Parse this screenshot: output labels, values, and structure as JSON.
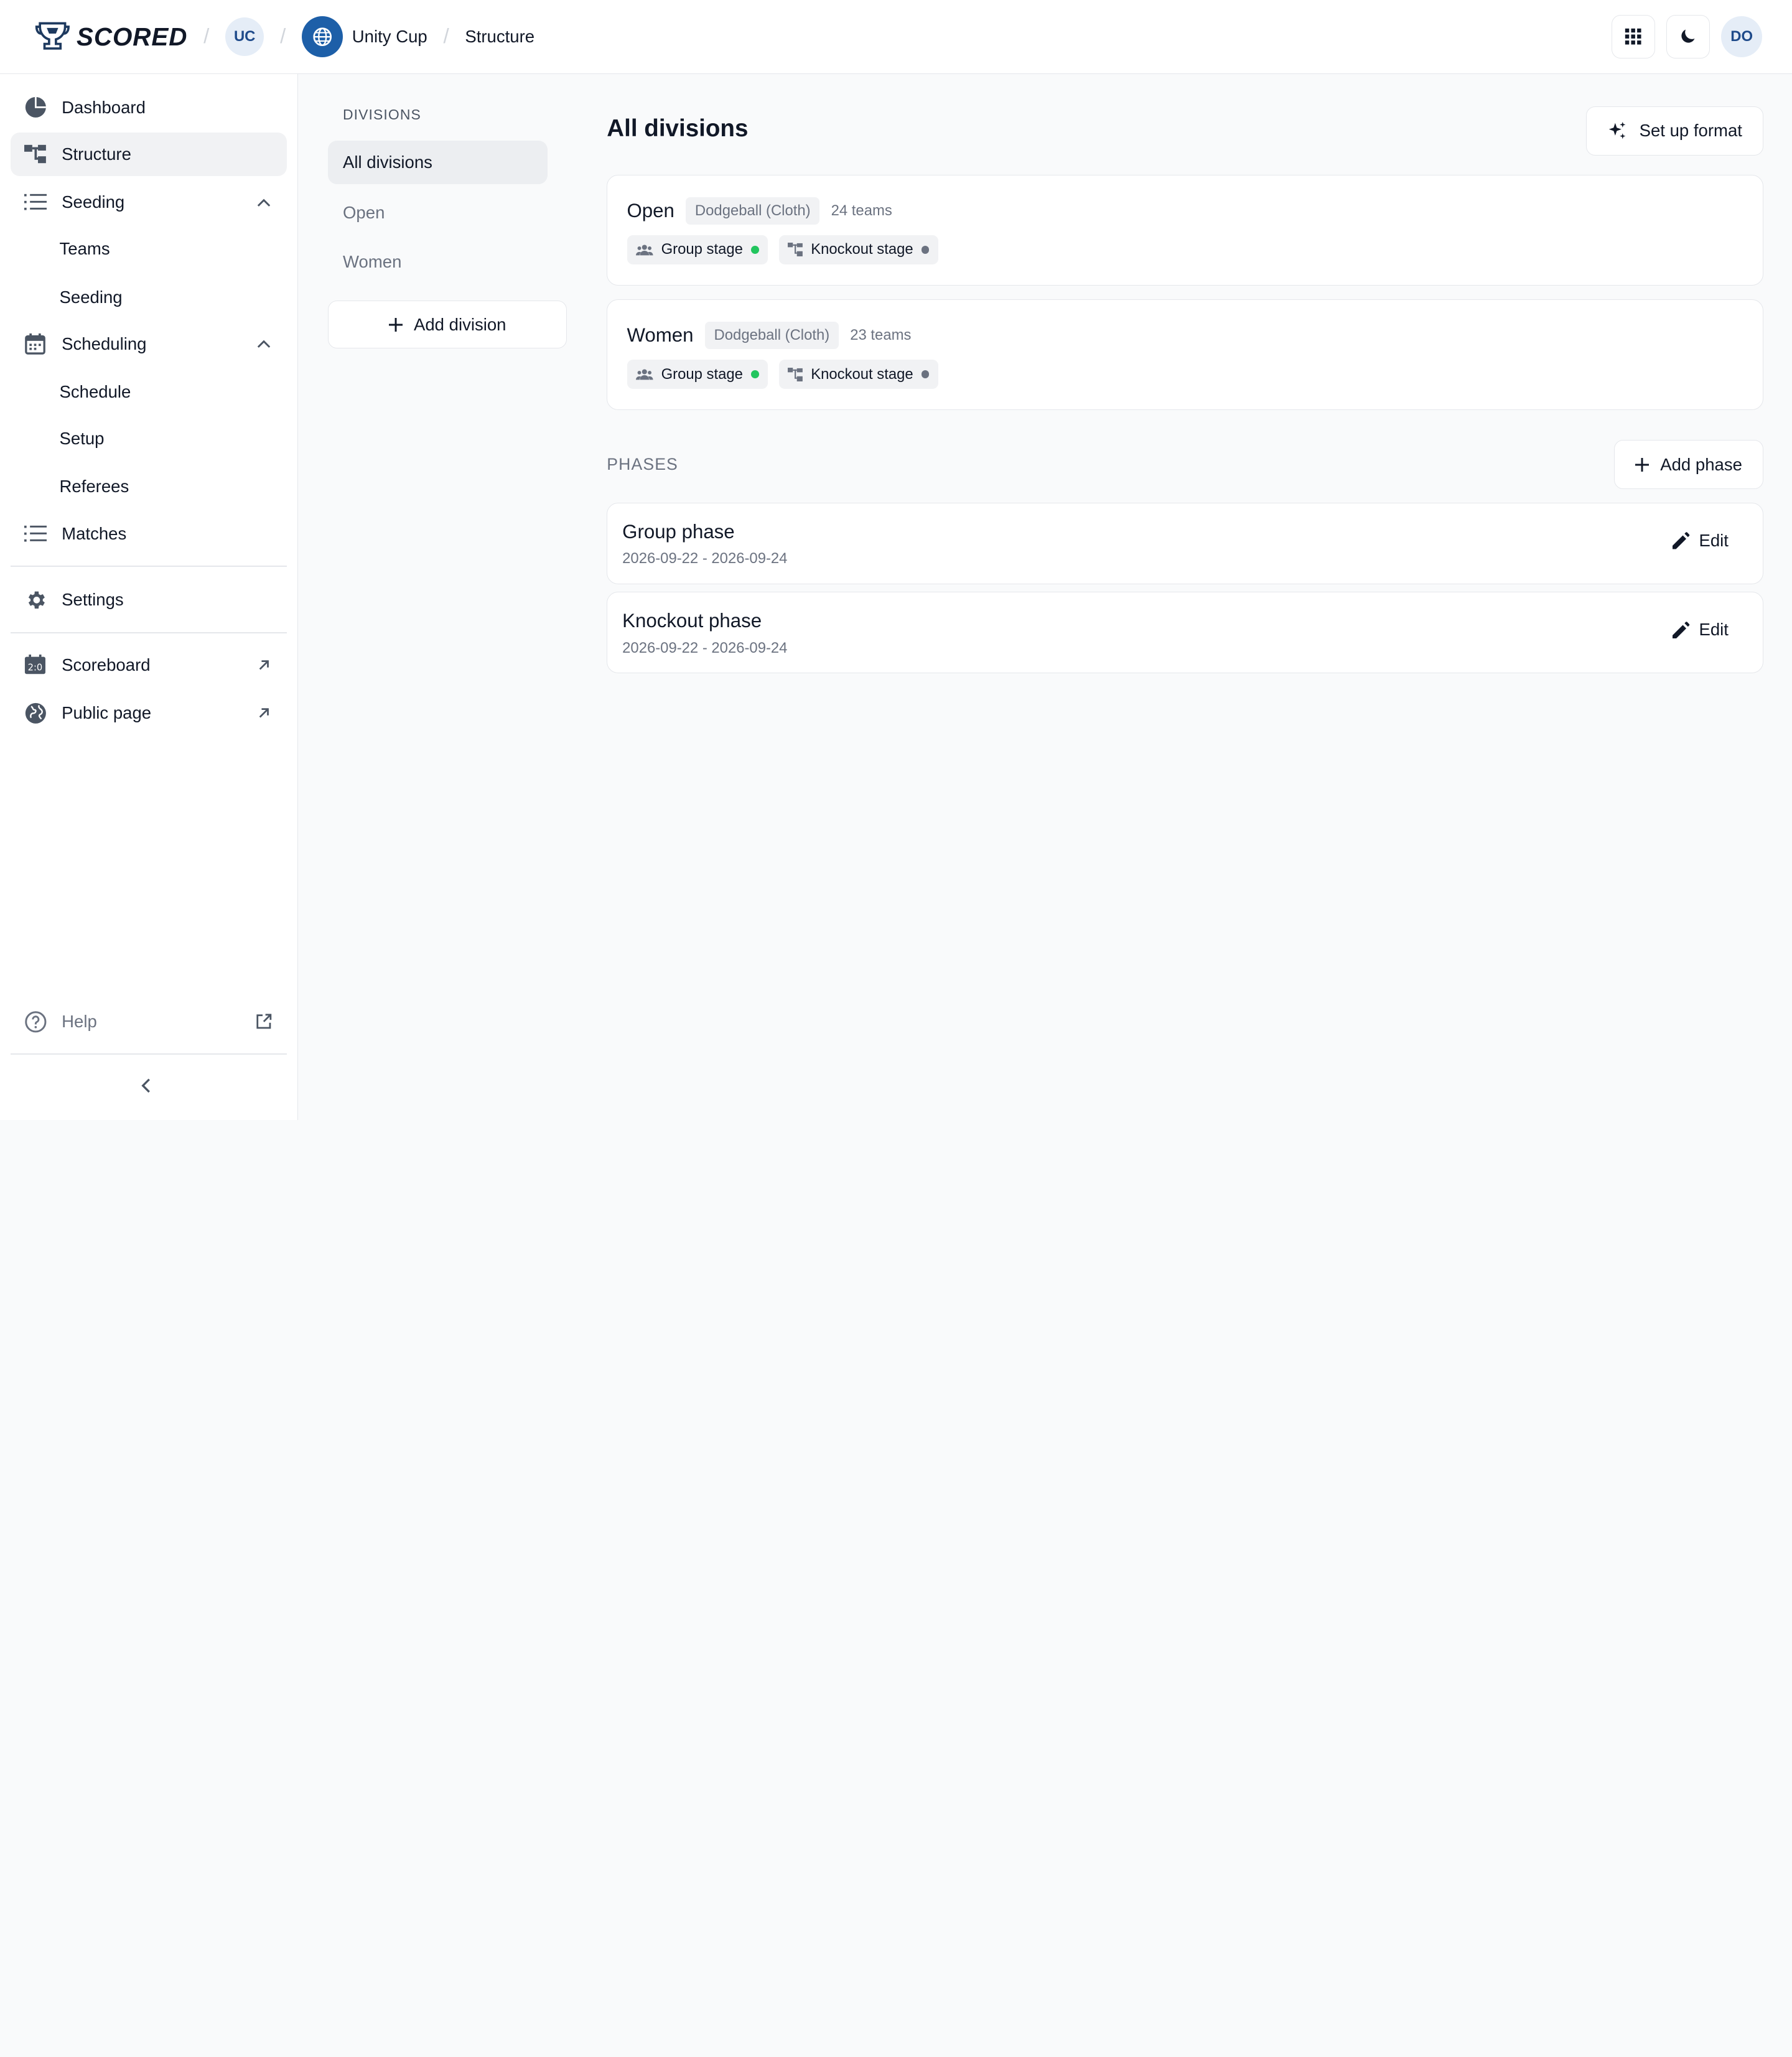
{
  "header": {
    "brand": "SCORED",
    "org_initials": "UC",
    "tournament": "Unity Cup",
    "page": "Structure",
    "user_initials": "DO",
    "icons": [
      "apps-grid-icon",
      "moon-icon"
    ]
  },
  "sidebar": {
    "dashboard": "Dashboard",
    "structure": "Structure",
    "seeding_group": "Seeding",
    "seeding_sub": [
      "Teams",
      "Seeding"
    ],
    "scheduling_group": "Scheduling",
    "scheduling_sub": [
      "Schedule",
      "Setup",
      "Referees"
    ],
    "matches": "Matches",
    "settings": "Settings",
    "scoreboard": "Scoreboard",
    "public_page": "Public page",
    "help": "Help"
  },
  "divisions_panel": {
    "label": "DIVISIONS",
    "items": [
      "All divisions",
      "Open",
      "Women"
    ],
    "add_label": "Add division"
  },
  "main": {
    "title": "All divisions",
    "setup_format": "Set up format",
    "divisions": [
      {
        "name": "Open",
        "sport": "Dodgeball (Cloth)",
        "teams": "24 teams",
        "stages": [
          {
            "label": "Group stage",
            "status_color": "#22c55e"
          },
          {
            "label": "Knockout stage",
            "status_color": "#6b7280"
          }
        ]
      },
      {
        "name": "Women",
        "sport": "Dodgeball (Cloth)",
        "teams": "23 teams",
        "stages": [
          {
            "label": "Group stage",
            "status_color": "#22c55e"
          },
          {
            "label": "Knockout stage",
            "status_color": "#6b7280"
          }
        ]
      }
    ],
    "phases_label": "PHASES",
    "add_phase": "Add phase",
    "phases": [
      {
        "name": "Group phase",
        "dates": "2026-09-22 - 2026-09-24",
        "edit": "Edit"
      },
      {
        "name": "Knockout phase",
        "dates": "2026-09-22 - 2026-09-24",
        "edit": "Edit"
      }
    ]
  },
  "colors": {
    "brand_blue": "#1d5fa8",
    "status_active": "#22c55e",
    "status_inactive": "#6b7280"
  }
}
